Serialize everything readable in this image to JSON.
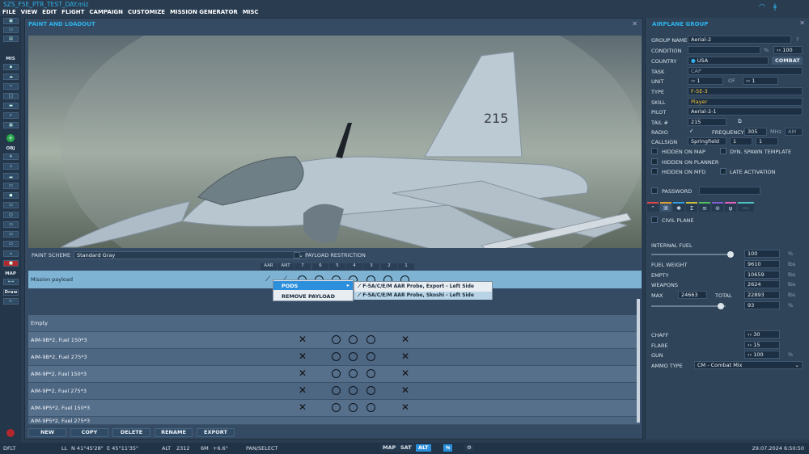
{
  "app": {
    "title": "SZS_F5E_PTR_TEST_DAY.miz"
  },
  "menu": [
    "FILE",
    "VIEW",
    "EDIT",
    "FLIGHT",
    "CAMPAIGN",
    "CUSTOMIZE",
    "MISSION GENERATOR",
    "MISC"
  ],
  "left_toolbar": {
    "mis_label": "MIS",
    "obj_label": "OBJ",
    "map_label": "MAP",
    "draw_label": "Draw"
  },
  "paint_panel": {
    "title": "PAINT AND LOADOUT",
    "paint_scheme_label": "PAINT SCHEME",
    "paint_scheme_value": "Standard Gray",
    "payload_restriction_label": "PAYLOAD RESTRICTION",
    "columns": [
      "AAR",
      "ANT",
      "7",
      "6",
      "5",
      "4",
      "3",
      "2",
      "1"
    ],
    "mission_payload_label": "Mission payload",
    "rows": [
      "Empty",
      "AIM-9B*2, Fuel 150*3",
      "AIM-9B*2, Fuel 275*3",
      "AIM-9P*2, Fuel 150*3",
      "AIM-9P*2, Fuel 275*3",
      "AIM-9P5*2, Fuel 150*3",
      "AIM-9P5*2, Fuel 275*3"
    ],
    "context_menu": {
      "pods": "PODS",
      "remove": "REMOVE PAYLOAD"
    },
    "submenu": [
      "F-5A/C/E/M AAR Probe, Export - Left Side",
      "F-5A/C/E/M AAR Probe, Skoshi - Left Side"
    ],
    "buttons": [
      "NEW",
      "COPY",
      "DELETE",
      "RENAME",
      "EXPORT"
    ]
  },
  "airplane_group": {
    "title": "AIRPLANE GROUP",
    "group_name_label": "GROUP NAME",
    "group_name": "Aerial-2",
    "condition_label": "CONDITION",
    "condition_pct": "%",
    "condition_value": "100",
    "country_label": "COUNTRY",
    "country": "USA",
    "combat_label": "COMBAT",
    "task_label": "TASK",
    "task": "CAP",
    "unit_label": "UNIT",
    "unit": "1",
    "of_label": "OF",
    "of_value": "1",
    "type_label": "TYPE",
    "type": "F-5E-3",
    "skill_label": "SKILL",
    "skill": "Player",
    "pilot_label": "PILOT",
    "pilot": "Aerial-2-1",
    "tail_label": "TAIL #",
    "tail": "215",
    "radio_label": "RADIO",
    "frequency_label": "FREQUENCY",
    "frequency": "305",
    "mhz": "MHz",
    "am": "AM",
    "callsign_label": "CALLSIGN",
    "callsign": "Springfield",
    "callsign_n1": "1",
    "callsign_n2": "1",
    "hidden_on_map": "HIDDEN ON MAP",
    "dyn_spawn": "DYN. SPAWN TEMPLATE",
    "hidden_on_planner": "HIDDEN ON PLANNER",
    "hidden_on_mfd": "HIDDEN ON MFD",
    "late_activation": "LATE ACTIVATION",
    "password_label": "PASSWORD",
    "civil_plane": "CIVIL PLANE",
    "internal_fuel_label": "INTERNAL FUEL",
    "internal_fuel": "100",
    "fuel_pct": "%",
    "fuel_weight_label": "FUEL WEIGHT",
    "fuel_weight": "9610",
    "empty_label": "EMPTY",
    "empty": "10659",
    "weapons_label": "WEAPONS",
    "weapons": "2624",
    "max_label": "MAX",
    "max": "24663",
    "total_label": "TOTAL",
    "total": "22893",
    "slider_pct": "93",
    "lbs": "lbs",
    "chaff_label": "CHAFF",
    "chaff": "30",
    "flare_label": "FLARE",
    "flare": "15",
    "gun_label": "GUN",
    "gun": "100",
    "ammo_type_label": "AMMO TYPE",
    "ammo_type": "CM - Combat Mix",
    "fuel_level": 0.98,
    "slider2_level": 0.93
  },
  "status": {
    "mode": "DFLT",
    "ll_label": "LL",
    "lat": "N 41°45'28\"",
    "lon": "E 45°11'35\"",
    "alt_label": "ALT",
    "alt": "2312",
    "mag": "6M",
    "mag_var": "+6.6°",
    "pan": "PAN/SELECT",
    "map": "MAP",
    "sat": "SAT",
    "alt_btn": "ALT",
    "datetime": "29.07.2024 6:50:50"
  }
}
